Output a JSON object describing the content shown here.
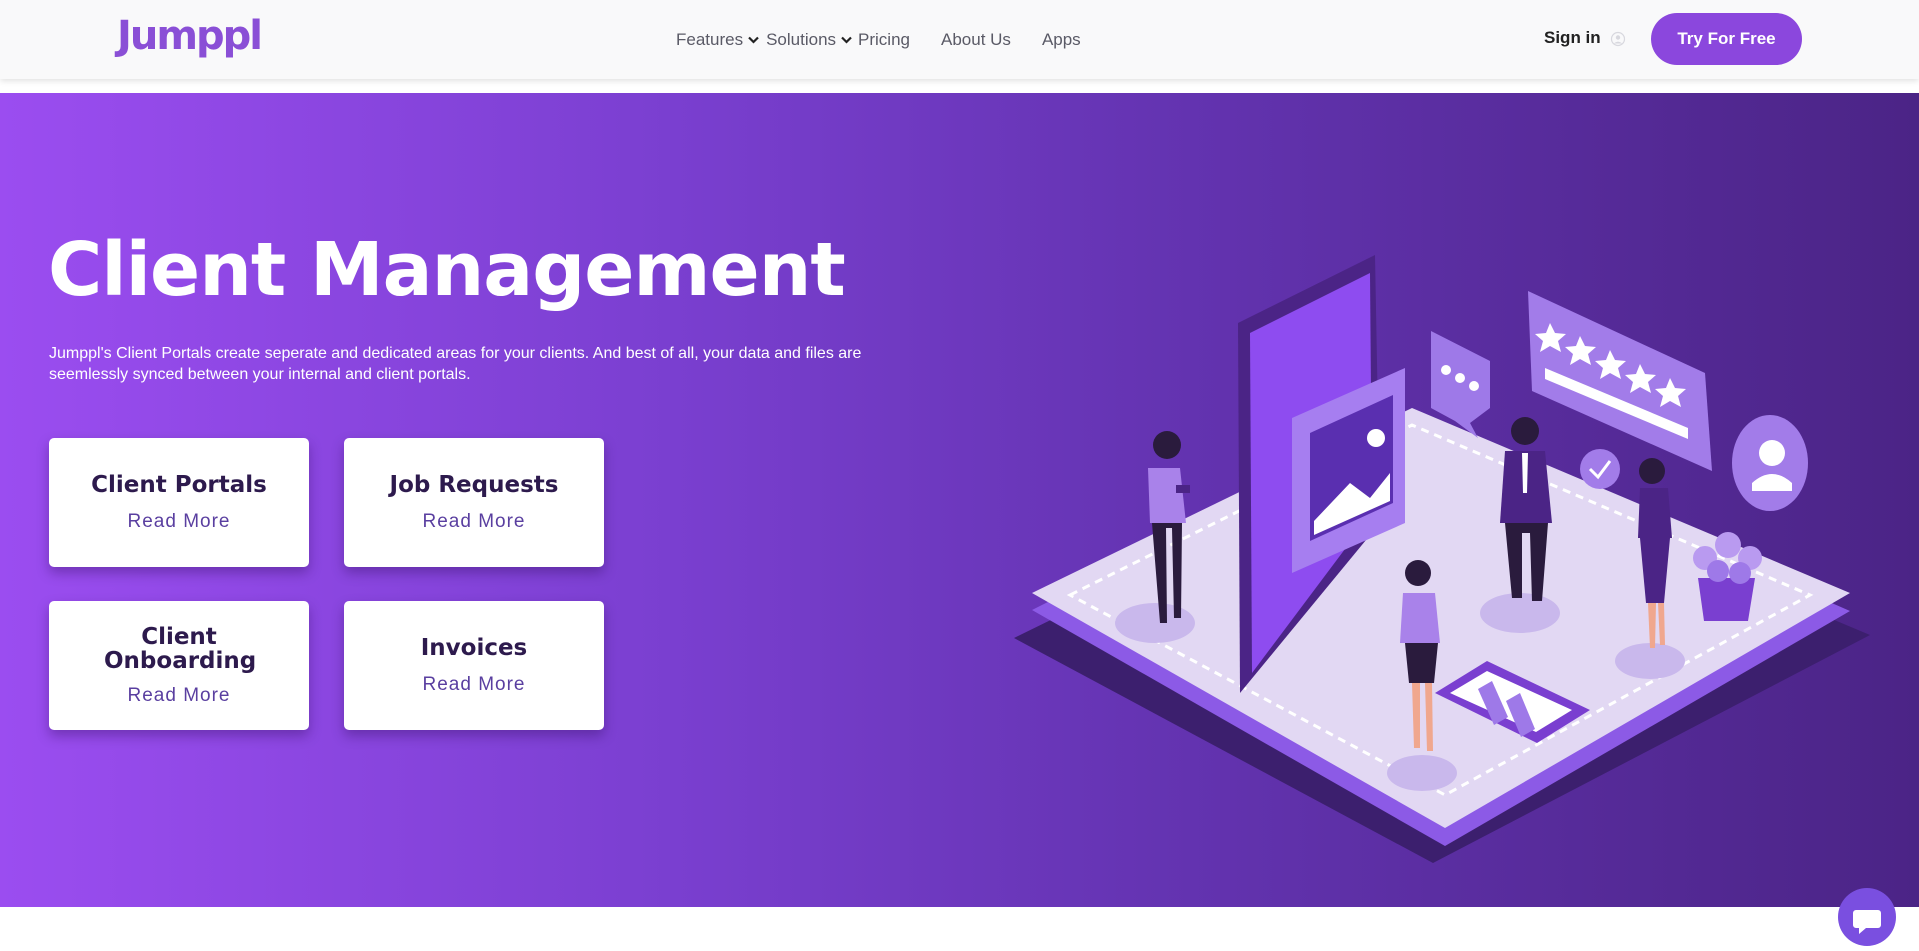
{
  "brand": {
    "name": "Jumppl",
    "color": "#8a4fd6"
  },
  "nav": {
    "features": "Features",
    "solutions": "Solutions",
    "pricing": "Pricing",
    "about": "About Us",
    "apps": "Apps",
    "signin": "Sign in",
    "cta": "Try For Free"
  },
  "hero": {
    "title": "Client Management",
    "description": "Jumppl's Client Portals create seperate and dedicated areas for your clients. And best of all, your data and files are seemlessly synced between your internal and client portals."
  },
  "cards": [
    {
      "title": "Client Portals",
      "link": "Read More"
    },
    {
      "title": "Job Requests",
      "link": "Read More"
    },
    {
      "title": "Client Onboarding",
      "link": "Read More"
    },
    {
      "title": "Invoices",
      "link": "Read More"
    }
  ],
  "colors": {
    "accent": "#8b47dd",
    "hero_start": "#9b4df0",
    "hero_end": "#4b2486",
    "card_text": "#2d1a4d",
    "link": "#5a3fa0"
  },
  "icons": [
    "chevron-down-icon",
    "user-icon",
    "chat-icon"
  ]
}
